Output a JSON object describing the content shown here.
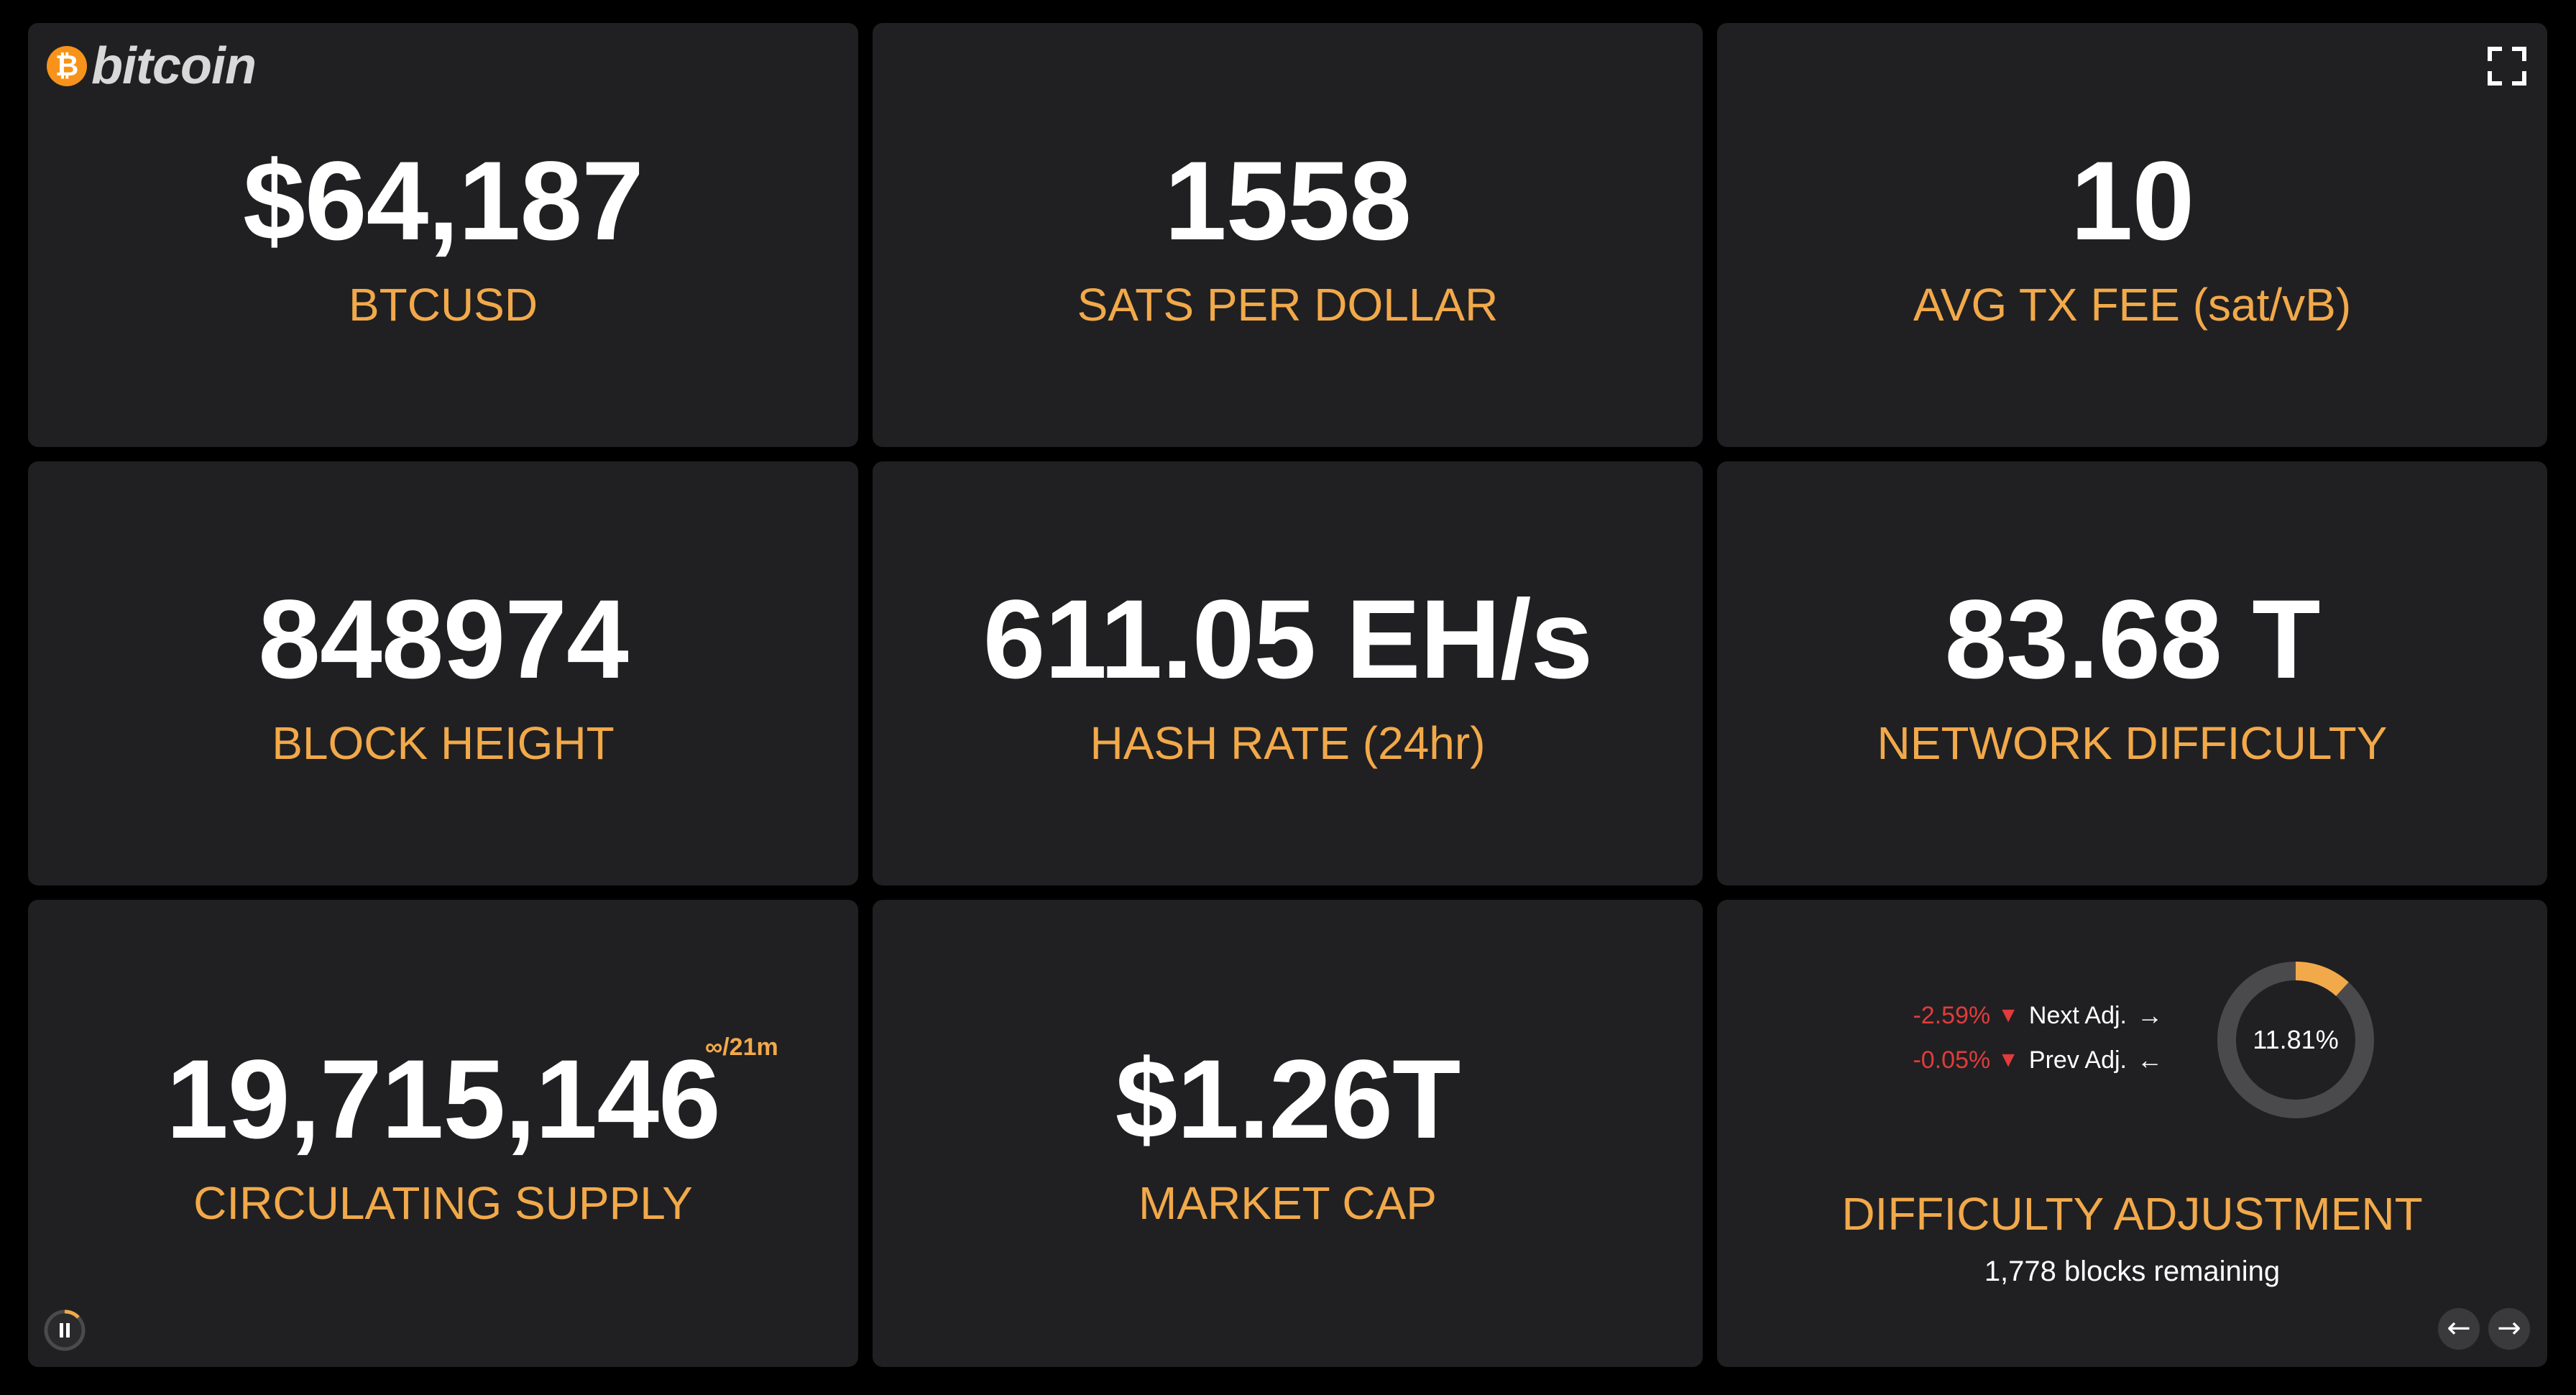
{
  "logo": {
    "coin_symbol": "₿",
    "text": "bitcoin"
  },
  "cards": {
    "price": {
      "value": "$64,187",
      "label": "BTCUSD"
    },
    "sats": {
      "value": "1558",
      "label": "SATS PER DOLLAR"
    },
    "fee": {
      "value": "10",
      "label": "AVG TX FEE (sat/vB)"
    },
    "height": {
      "value": "848974",
      "label": "BLOCK HEIGHT"
    },
    "hashrate": {
      "value": "611.05 EH/s",
      "label": "HASH RATE (24hr)"
    },
    "difficulty": {
      "value": "83.68 T",
      "label": "NETWORK DIFFICULTY"
    },
    "supply": {
      "value": "19,715,146",
      "sup": "∞/21m",
      "label": "CIRCULATING SUPPLY"
    },
    "marketcap": {
      "value": "$1.26T",
      "label": "MARKET CAP"
    }
  },
  "adjustment": {
    "next": {
      "pct": "-2.59%",
      "name": "Next Adj.",
      "arrow": "→"
    },
    "prev": {
      "pct": "-0.05%",
      "name": "Prev Adj.",
      "arrow": "←"
    },
    "progress_percent": 11.81,
    "progress_text": "11.81%",
    "label": "DIFFICULTY ADJUSTMENT",
    "sub": "1,778 blocks remaining"
  },
  "colors": {
    "accent": "#f2a94a",
    "negative": "#e23b3b",
    "card_bg": "#202022",
    "page_bg": "#000000",
    "bitcoin_orange": "#f7931a"
  },
  "icons": {
    "fullscreen": "fullscreen-icon",
    "pause": "pause-icon",
    "prev": "arrow-left-icon",
    "next": "arrow-right-icon",
    "down_triangle": "▼"
  },
  "nav": {
    "prev_arrow": "←",
    "next_arrow": "→"
  }
}
